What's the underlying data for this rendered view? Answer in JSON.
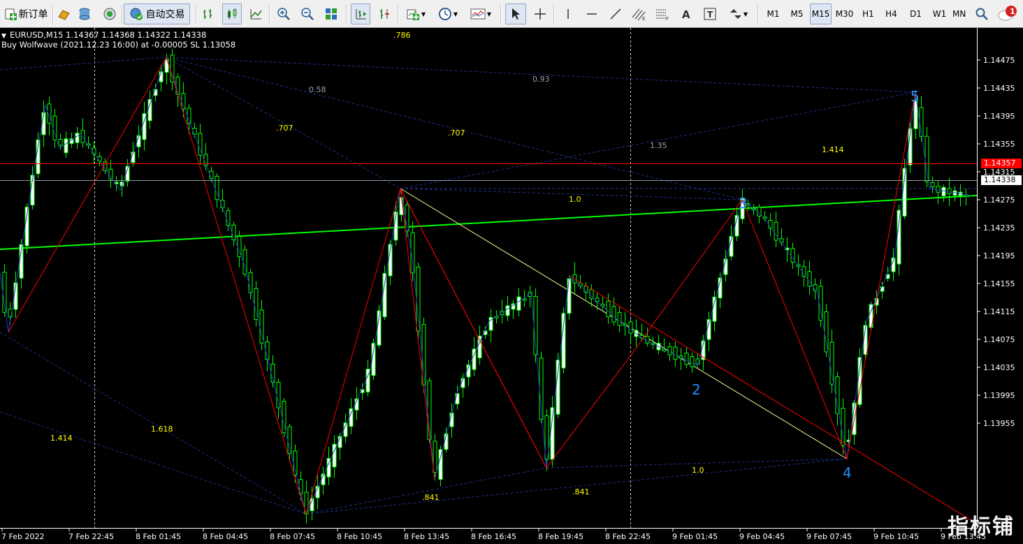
{
  "toolbar": {
    "new_order": "新订单",
    "auto_trading": "自动交易",
    "timeframes": [
      "M1",
      "M5",
      "M15",
      "M30",
      "H1",
      "H4",
      "D1",
      "W1",
      "MN"
    ],
    "active_timeframe": "M15",
    "notification_count": "1"
  },
  "chart": {
    "header_line1": "EURUSD,M15  1.14367 1.14368 1.14322 1.14338",
    "header_line2": "Buy Wolfwave (2021.12.23 16:00) at -0.00005 SL 1.13058",
    "bid_price": "1.14338",
    "alert_price": "1.14357",
    "price_axis": [
      "1.14475",
      "1.14435",
      "1.14395",
      "1.14355",
      "1.14315",
      "1.14275",
      "1.14235",
      "1.14195",
      "1.14155",
      "1.14115",
      "1.14075",
      "1.14035",
      "1.13995",
      "1.13955"
    ],
    "time_axis": [
      "7 Feb 2022",
      "7 Feb 22:45",
      "8 Feb 01:45",
      "8 Feb 04:45",
      "8 Feb 07:45",
      "8 Feb 10:45",
      "8 Feb 13:45",
      "8 Feb 16:45",
      "8 Feb 19:45",
      "8 Feb 22:45",
      "9 Feb 01:45",
      "9 Feb 04:45",
      "9 Feb 07:45",
      "9 Feb 10:45",
      "9 Feb 13:45"
    ],
    "wave_points": [
      "2",
      "3",
      "4",
      "5"
    ],
    "fib_labels": [
      ".786",
      "0.58",
      "0.93",
      ".707",
      ".707",
      "1.35",
      "1.414",
      "1.0",
      "1.414",
      "1.618",
      ".841",
      ".841",
      "1.0"
    ],
    "watermark": "指标铺",
    "colors": {
      "candle_up": "#ffffff",
      "candle_down": "#000000",
      "candle_border": "#00ff00",
      "wolfwave_line": "#ff0000",
      "target_line": "#00ff00",
      "fib_line": "#1f2f8a",
      "label_yellow": "#ffff00",
      "label_gray": "#a0a0b0",
      "wave_number": "#1e90ff"
    }
  }
}
